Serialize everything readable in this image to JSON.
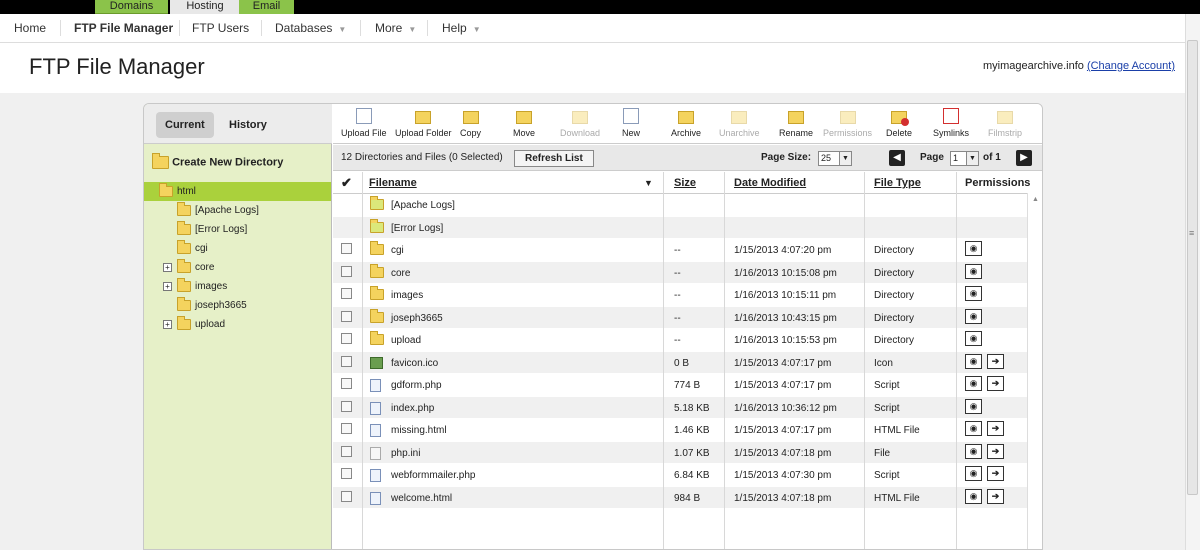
{
  "top_tabs": [
    "Domains",
    "Hosting",
    "Email"
  ],
  "subnav": [
    {
      "label": "Home",
      "bold": false,
      "dropdown": false
    },
    {
      "label": "FTP File Manager",
      "bold": true,
      "dropdown": false
    },
    {
      "label": "FTP Users",
      "bold": false,
      "dropdown": false
    },
    {
      "label": "Databases",
      "bold": false,
      "dropdown": true
    },
    {
      "label": "More",
      "bold": false,
      "dropdown": true
    },
    {
      "label": "Help",
      "bold": false,
      "dropdown": true
    }
  ],
  "page": {
    "title": "FTP File Manager",
    "domain": "myimagearchive.info",
    "change_account": "(Change Account)"
  },
  "left": {
    "tabs": [
      "Current",
      "History"
    ],
    "create_dir": "Create New Directory",
    "tree": [
      {
        "label": "html",
        "expand": false,
        "selected": true
      },
      {
        "label": "[Apache Logs]",
        "expand": false,
        "selected": false
      },
      {
        "label": "[Error Logs]",
        "expand": false,
        "selected": false
      },
      {
        "label": "cgi",
        "expand": false,
        "selected": false
      },
      {
        "label": "core",
        "expand": true,
        "selected": false
      },
      {
        "label": "images",
        "expand": true,
        "selected": false
      },
      {
        "label": "joseph3665",
        "expand": false,
        "selected": false
      },
      {
        "label": "upload",
        "expand": true,
        "selected": false
      }
    ]
  },
  "toolbar": [
    {
      "label": "Upload File",
      "icon": "upload-file-icon",
      "enabled": true
    },
    {
      "label": "Upload Folder",
      "icon": "upload-folder-icon",
      "enabled": true
    },
    {
      "label": "Copy",
      "icon": "copy-icon",
      "enabled": true
    },
    {
      "label": "Move",
      "icon": "move-icon",
      "enabled": true
    },
    {
      "label": "Download",
      "icon": "download-icon",
      "enabled": false
    },
    {
      "label": "New",
      "icon": "new-file-icon",
      "enabled": true
    },
    {
      "label": "Archive",
      "icon": "archive-icon",
      "enabled": true
    },
    {
      "label": "Unarchive",
      "icon": "unarchive-icon",
      "enabled": false
    },
    {
      "label": "Rename",
      "icon": "rename-icon",
      "enabled": true
    },
    {
      "label": "Permissions",
      "icon": "permissions-icon",
      "enabled": false
    },
    {
      "label": "Delete",
      "icon": "delete-icon",
      "enabled": true
    },
    {
      "label": "Symlinks",
      "icon": "symlinks-icon",
      "enabled": true
    },
    {
      "label": "Filmstrip",
      "icon": "filmstrip-icon",
      "enabled": false
    }
  ],
  "info": {
    "count": "12 Directories and Files (0 Selected)",
    "refresh": "Refresh List",
    "page_size_label": "Page Size:",
    "page_size": "25",
    "page_label": "Page",
    "page": "1",
    "of": "of 1"
  },
  "columns": {
    "check": "✔",
    "filename": "Filename",
    "size": "Size",
    "date": "Date Modified",
    "type": "File Type",
    "permissions": "Permissions"
  },
  "rows": [
    {
      "name": "[Apache Logs]",
      "size": "",
      "date": "",
      "type": "",
      "kind": "logfolder",
      "checkbox": false,
      "edit": false,
      "view": false
    },
    {
      "name": "[Error Logs]",
      "size": "",
      "date": "",
      "type": "",
      "kind": "logfolder",
      "checkbox": false,
      "edit": false,
      "view": false
    },
    {
      "name": "cgi",
      "size": "--",
      "date": "1/15/2013 4:07:20 pm",
      "type": "Directory",
      "kind": "folder",
      "checkbox": true,
      "edit": false,
      "view": true
    },
    {
      "name": "core",
      "size": "--",
      "date": "1/16/2013 10:15:08 pm",
      "type": "Directory",
      "kind": "folder",
      "checkbox": true,
      "edit": false,
      "view": true
    },
    {
      "name": "images",
      "size": "--",
      "date": "1/16/2013 10:15:11 pm",
      "type": "Directory",
      "kind": "folder",
      "checkbox": true,
      "edit": false,
      "view": true
    },
    {
      "name": "joseph3665",
      "size": "--",
      "date": "1/16/2013 10:43:15 pm",
      "type": "Directory",
      "kind": "folder",
      "checkbox": true,
      "edit": false,
      "view": true
    },
    {
      "name": "upload",
      "size": "--",
      "date": "1/16/2013 10:15:53 pm",
      "type": "Directory",
      "kind": "folder",
      "checkbox": true,
      "edit": false,
      "view": true
    },
    {
      "name": "favicon.ico",
      "size": "0 B",
      "date": "1/15/2013 4:07:17 pm",
      "type": "Icon",
      "kind": "image",
      "checkbox": true,
      "edit": true,
      "view": true
    },
    {
      "name": "gdform.php",
      "size": "774 B",
      "date": "1/15/2013 4:07:17 pm",
      "type": "Script",
      "kind": "script",
      "checkbox": true,
      "edit": true,
      "view": true
    },
    {
      "name": "index.php",
      "size": "5.18 KB",
      "date": "1/16/2013 10:36:12 pm",
      "type": "Script",
      "kind": "script",
      "checkbox": true,
      "edit": false,
      "view": true
    },
    {
      "name": "missing.html",
      "size": "1.46 KB",
      "date": "1/15/2013 4:07:17 pm",
      "type": "HTML File",
      "kind": "html",
      "checkbox": true,
      "edit": true,
      "view": true
    },
    {
      "name": "php.ini",
      "size": "1.07 KB",
      "date": "1/15/2013 4:07:18 pm",
      "type": "File",
      "kind": "generic",
      "checkbox": true,
      "edit": true,
      "view": true
    },
    {
      "name": "webformmailer.php",
      "size": "6.84 KB",
      "date": "1/15/2013 4:07:30 pm",
      "type": "Script",
      "kind": "script",
      "checkbox": true,
      "edit": true,
      "view": true
    },
    {
      "name": "welcome.html",
      "size": "984 B",
      "date": "1/15/2013 4:07:18 pm",
      "type": "HTML File",
      "kind": "html",
      "checkbox": true,
      "edit": true,
      "view": true
    }
  ],
  "colors": {
    "accent_green": "#8bc34a",
    "tree_bg": "#e6f0c8",
    "tree_selected": "#aad13c"
  }
}
